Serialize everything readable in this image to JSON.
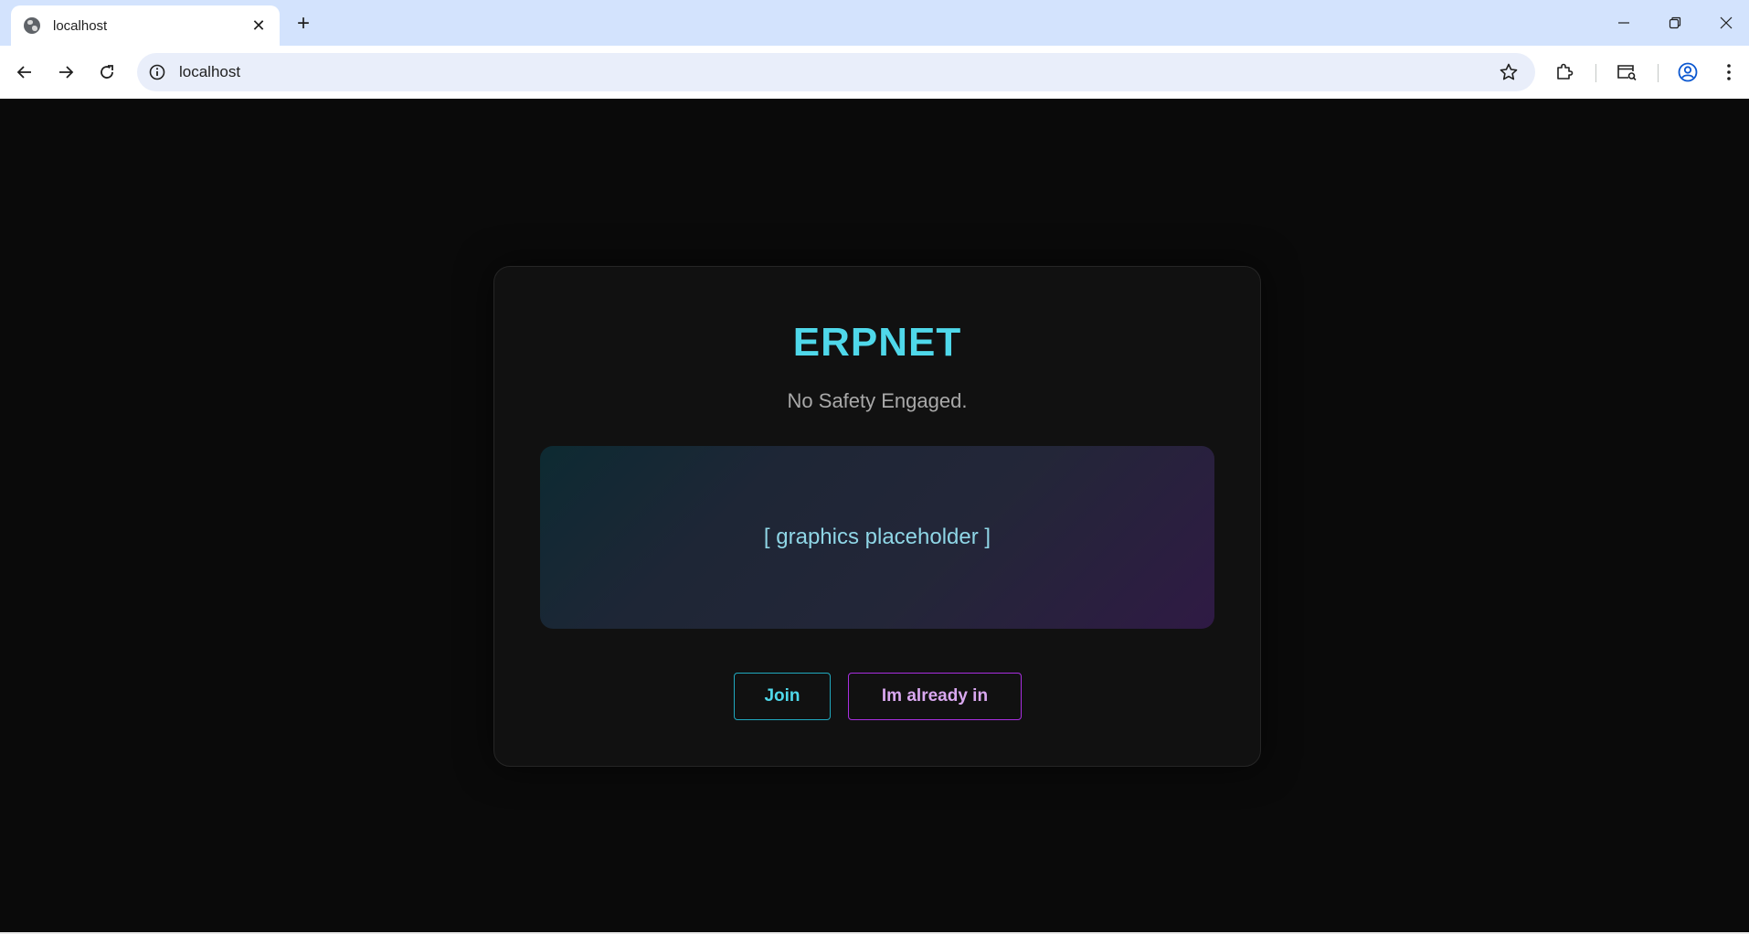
{
  "browser": {
    "tab_title": "localhost",
    "url": "localhost"
  },
  "page": {
    "brand": "ERPNET",
    "tagline": "No Safety Engaged.",
    "graphic_placeholder": "[ graphics placeholder ]",
    "join_label": "Join",
    "signin_label": "Im already in"
  },
  "colors": {
    "accent_cyan": "#4fd8ea",
    "accent_purple": "#a82fe0",
    "background": "#0a0a0a",
    "card": "#111111"
  }
}
